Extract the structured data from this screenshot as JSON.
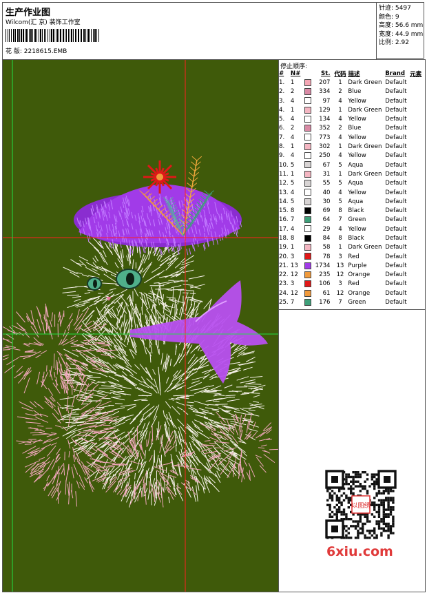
{
  "header": {
    "title": "生产作业图",
    "company": "Wilcom(汇 京) 装饰工作室",
    "design_file": "花 版:  2218615.EMB"
  },
  "stats": {
    "stitches": "针迹: 5497",
    "colors": "颜色: 9",
    "height": "高度: 56.6 mm",
    "width": "宽度: 44.9 mm",
    "scale": "比例: 2.92"
  },
  "sequence": {
    "title": "停止顺序:",
    "columns": [
      "#",
      "N#",
      "",
      "St.",
      "代码",
      "描述",
      "Brand",
      "元素"
    ],
    "rows": [
      {
        "idx": "1.",
        "n": "1",
        "color": "#f4a6b4",
        "st": "207",
        "code": "1",
        "desc": "Dark Green",
        "brand": "Default"
      },
      {
        "idx": "2.",
        "n": "2",
        "color": "#d98aa5",
        "st": "334",
        "code": "2",
        "desc": "Blue",
        "brand": "Default"
      },
      {
        "idx": "3.",
        "n": "4",
        "color": "#ffffff",
        "st": "97",
        "code": "4",
        "desc": "Yellow",
        "brand": "Default"
      },
      {
        "idx": "4.",
        "n": "1",
        "color": "#f4b6c2",
        "st": "129",
        "code": "1",
        "desc": "Dark Green",
        "brand": "Default"
      },
      {
        "idx": "5.",
        "n": "4",
        "color": "#ffffff",
        "st": "134",
        "code": "4",
        "desc": "Yellow",
        "brand": "Default"
      },
      {
        "idx": "6.",
        "n": "2",
        "color": "#d98aa5",
        "st": "352",
        "code": "2",
        "desc": "Blue",
        "brand": "Default"
      },
      {
        "idx": "7.",
        "n": "4",
        "color": "#ffffff",
        "st": "773",
        "code": "4",
        "desc": "Yellow",
        "brand": "Default"
      },
      {
        "idx": "8.",
        "n": "1",
        "color": "#f4b6c2",
        "st": "302",
        "code": "1",
        "desc": "Dark Green",
        "brand": "Default"
      },
      {
        "idx": "9.",
        "n": "4",
        "color": "#ffffff",
        "st": "250",
        "code": "4",
        "desc": "Yellow",
        "brand": "Default"
      },
      {
        "idx": "10.",
        "n": "5",
        "color": "#d8d4d4",
        "st": "67",
        "code": "5",
        "desc": "Aqua",
        "brand": "Default"
      },
      {
        "idx": "11.",
        "n": "1",
        "color": "#f4b6c2",
        "st": "31",
        "code": "1",
        "desc": "Dark Green",
        "brand": "Default"
      },
      {
        "idx": "12.",
        "n": "5",
        "color": "#d8d4d4",
        "st": "55",
        "code": "5",
        "desc": "Aqua",
        "brand": "Default"
      },
      {
        "idx": "13.",
        "n": "4",
        "color": "#ffffff",
        "st": "40",
        "code": "4",
        "desc": "Yellow",
        "brand": "Default"
      },
      {
        "idx": "14.",
        "n": "5",
        "color": "#d8d4d4",
        "st": "30",
        "code": "5",
        "desc": "Aqua",
        "brand": "Default"
      },
      {
        "idx": "15.",
        "n": "8",
        "color": "#000000",
        "st": "69",
        "code": "8",
        "desc": "Black",
        "brand": "Default"
      },
      {
        "idx": "16.",
        "n": "7",
        "color": "#3fa07a",
        "st": "64",
        "code": "7",
        "desc": "Green",
        "brand": "Default"
      },
      {
        "idx": "17.",
        "n": "4",
        "color": "#ffffff",
        "st": "29",
        "code": "4",
        "desc": "Yellow",
        "brand": "Default"
      },
      {
        "idx": "18.",
        "n": "8",
        "color": "#000000",
        "st": "84",
        "code": "8",
        "desc": "Black",
        "brand": "Default"
      },
      {
        "idx": "19.",
        "n": "1",
        "color": "#f4b6c2",
        "st": "58",
        "code": "1",
        "desc": "Dark Green",
        "brand": "Default"
      },
      {
        "idx": "20.",
        "n": "3",
        "color": "#e01818",
        "st": "78",
        "code": "3",
        "desc": "Red",
        "brand": "Default"
      },
      {
        "idx": "21.",
        "n": "13",
        "color": "#a13be8",
        "st": "1734",
        "code": "13",
        "desc": "Purple",
        "brand": "Default"
      },
      {
        "idx": "22.",
        "n": "12",
        "color": "#f09a3c",
        "st": "235",
        "code": "12",
        "desc": "Orange",
        "brand": "Default"
      },
      {
        "idx": "23.",
        "n": "3",
        "color": "#e01818",
        "st": "106",
        "code": "3",
        "desc": "Red",
        "brand": "Default"
      },
      {
        "idx": "24.",
        "n": "12",
        "color": "#f09a3c",
        "st": "61",
        "code": "12",
        "desc": "Orange",
        "brand": "Default"
      },
      {
        "idx": "25.",
        "n": "7",
        "color": "#3fa07a",
        "st": "176",
        "code": "7",
        "desc": "Green",
        "brand": "Default"
      }
    ]
  },
  "watermark": {
    "site": "6xiu.com",
    "seal_text": "以图绣"
  },
  "colors": {
    "design_background": "#3f5a0a",
    "guide_red": "#ff2020",
    "guide_green": "#22e044",
    "cat_white": "#f6f1e9",
    "cat_pink": "#f2a7bd",
    "hat_purple": "#a13be8",
    "bow_purple": "#b850f0"
  }
}
